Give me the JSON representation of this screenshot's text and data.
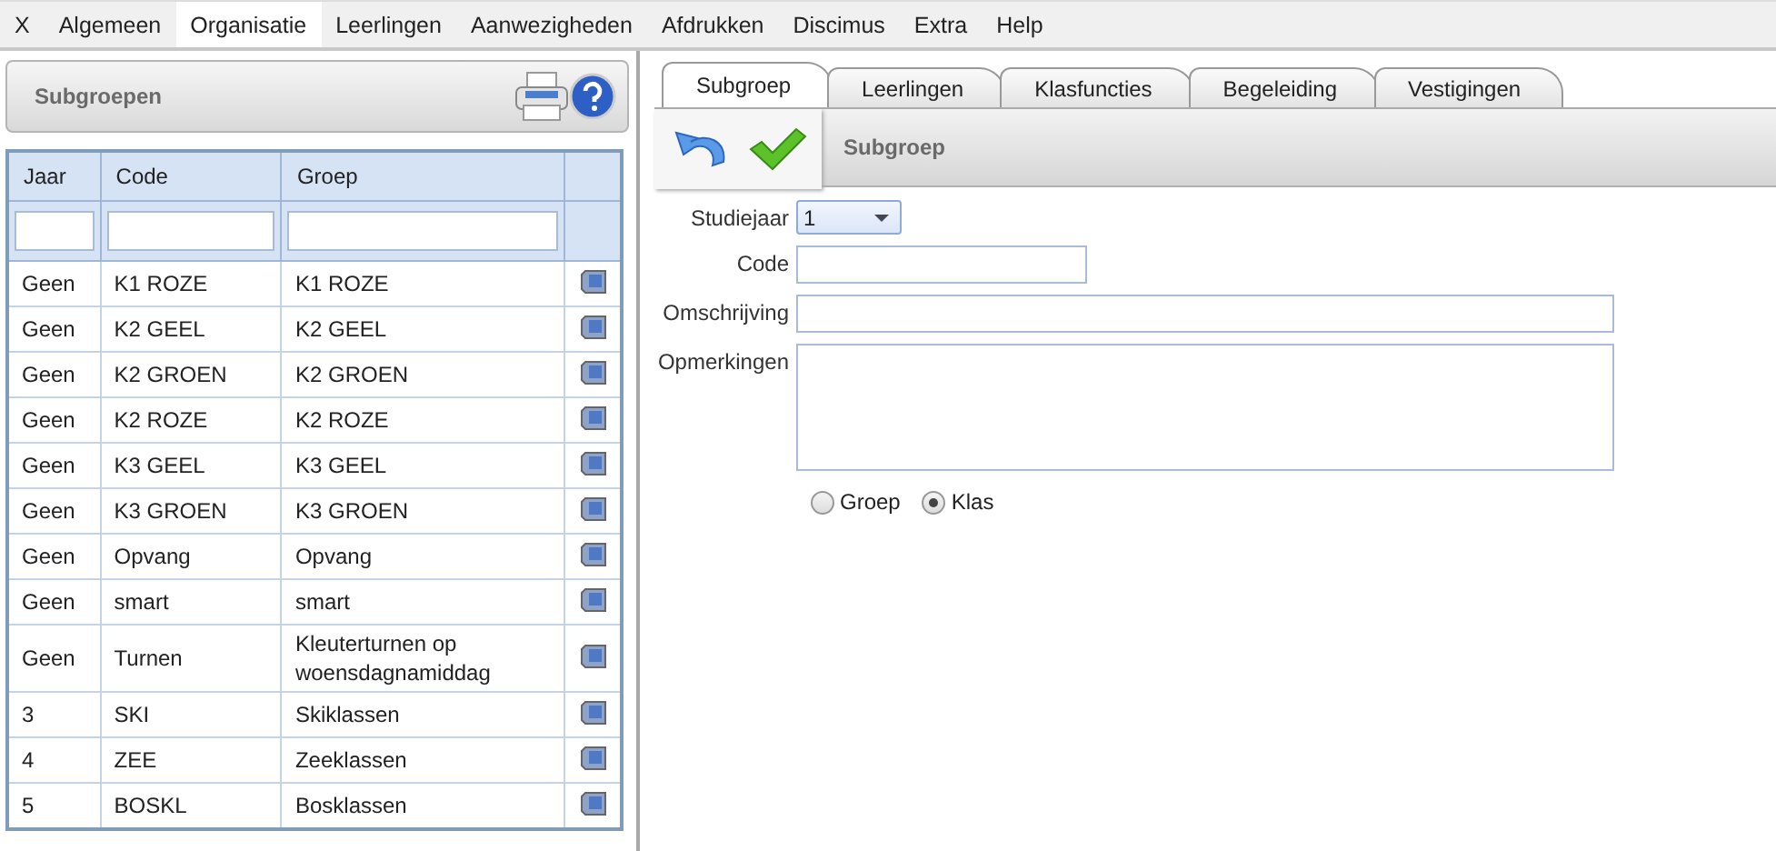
{
  "menu": [
    {
      "label": "X",
      "selected": false
    },
    {
      "label": "Algemeen",
      "selected": false
    },
    {
      "label": "Organisatie",
      "selected": true
    },
    {
      "label": "Leerlingen",
      "selected": false
    },
    {
      "label": "Aanwezigheden",
      "selected": false
    },
    {
      "label": "Afdrukken",
      "selected": false
    },
    {
      "label": "Discimus",
      "selected": false
    },
    {
      "label": "Extra",
      "selected": false
    },
    {
      "label": "Help",
      "selected": false
    }
  ],
  "list_panel": {
    "title": "Subgroepen"
  },
  "table": {
    "columns": [
      "Jaar",
      "Code",
      "Groep"
    ],
    "rows": [
      {
        "jaar": "Geen",
        "code": "K1 ROZE",
        "groep": "K1 ROZE"
      },
      {
        "jaar": "Geen",
        "code": "K2 GEEL",
        "groep": "K2 GEEL"
      },
      {
        "jaar": "Geen",
        "code": "K2 GROEN",
        "groep": "K2 GROEN"
      },
      {
        "jaar": "Geen",
        "code": "K2 ROZE",
        "groep": "K2 ROZE"
      },
      {
        "jaar": "Geen",
        "code": "K3 GEEL",
        "groep": "K3 GEEL"
      },
      {
        "jaar": "Geen",
        "code": "K3 GROEN",
        "groep": "K3 GROEN"
      },
      {
        "jaar": "Geen",
        "code": "Opvang",
        "groep": "Opvang"
      },
      {
        "jaar": "Geen",
        "code": "smart",
        "groep": "smart"
      },
      {
        "jaar": "Geen",
        "code": "Turnen",
        "groep": "Kleuterturnen op woensdagnamiddag"
      },
      {
        "jaar": "3",
        "code": "SKI",
        "groep": "Skiklassen"
      },
      {
        "jaar": "4",
        "code": "ZEE",
        "groep": "Zeeklassen"
      },
      {
        "jaar": "5",
        "code": "BOSKL",
        "groep": "Bosklassen"
      }
    ]
  },
  "tabs": [
    {
      "label": "Subgroep",
      "selected": true
    },
    {
      "label": "Leerlingen",
      "selected": false
    },
    {
      "label": "Klasfuncties",
      "selected": false
    },
    {
      "label": "Begeleiding",
      "selected": false
    },
    {
      "label": "Vestigingen",
      "selected": false
    }
  ],
  "toolbar": {
    "title": "Subgroep"
  },
  "form": {
    "fields": [
      {
        "kind": "select",
        "label": "Studiejaar",
        "value": "1"
      },
      {
        "kind": "short",
        "label": "Code"
      },
      {
        "kind": "long",
        "label": "Omschrijving"
      },
      {
        "kind": "area",
        "label": "Opmerkingen"
      }
    ],
    "radios": [
      {
        "label": "Groep",
        "selected": false
      },
      {
        "label": "Klas",
        "selected": true
      }
    ]
  }
}
